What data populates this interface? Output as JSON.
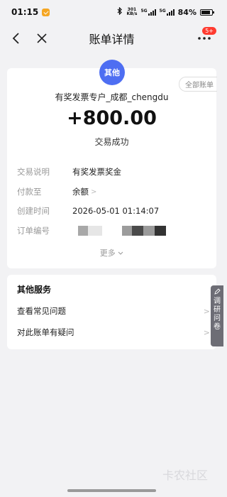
{
  "status_bar": {
    "time": "01:15",
    "net_speed_top": "301",
    "net_speed_bottom": "KB/s",
    "sim1": "5G",
    "sim2": "5G",
    "battery": "84%"
  },
  "nav": {
    "title": "账单详情",
    "badge": "5+"
  },
  "bill": {
    "logo_text": "其他",
    "all_bills": "全部账单",
    "merchant": "有奖发票专户_成都_chengdu",
    "amount": "+800.00",
    "status": "交易成功",
    "details": [
      {
        "label": "交易说明",
        "value": "有奖发票奖金"
      },
      {
        "label": "付款至",
        "value": "余额"
      },
      {
        "label": "创建时间",
        "value": "2026-05-01 01:14:07"
      },
      {
        "label": "订单编号",
        "value": ""
      }
    ],
    "more": "更多"
  },
  "services": {
    "title": "其他服务",
    "items": [
      {
        "label": "查看常见问题"
      },
      {
        "label": "对此账单有疑问"
      }
    ]
  },
  "survey": {
    "chars": [
      "调",
      "研",
      "问",
      "卷"
    ]
  },
  "watermark": "卡农社区"
}
